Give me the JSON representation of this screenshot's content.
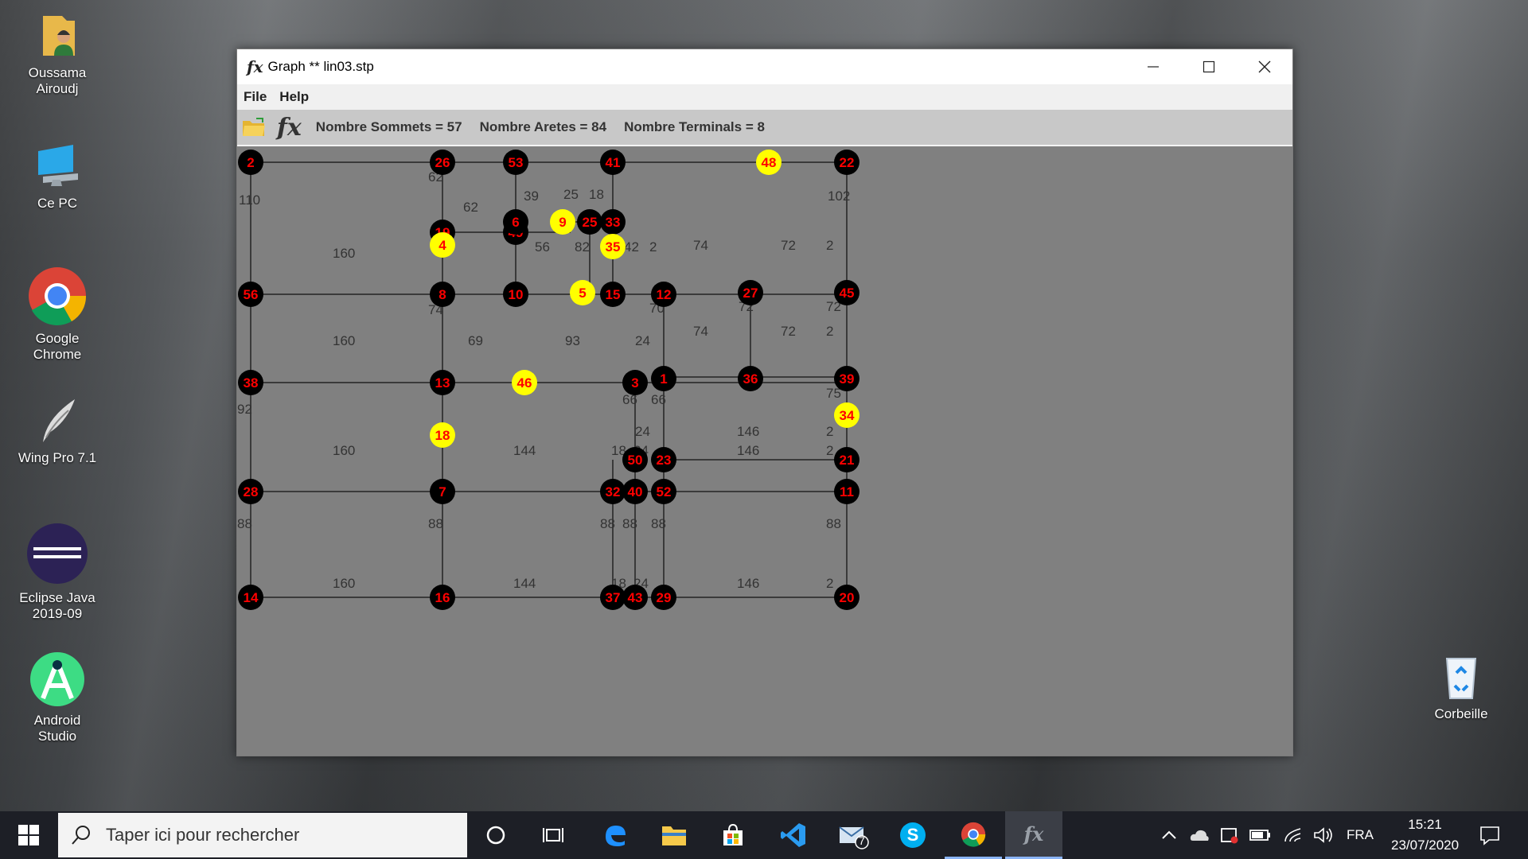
{
  "desktop": {
    "icons": [
      {
        "label": "Oussama Airoudj",
        "icon": "user-folder-icon"
      },
      {
        "label": "Ce PC",
        "icon": "computer-icon"
      },
      {
        "label": "Google Chrome",
        "icon": "chrome-icon"
      },
      {
        "label": "Wing Pro 7.1",
        "icon": "wing-icon"
      },
      {
        "label": "Eclipse Java 2019-09",
        "icon": "eclipse-icon"
      },
      {
        "label": "Android Studio",
        "icon": "android-studio-icon"
      },
      {
        "label": "Corbeille",
        "icon": "recycle-bin-icon"
      }
    ]
  },
  "window": {
    "fx_glyph": "fx",
    "title": "Graph ** lin03.stp",
    "menu": [
      "File",
      "Help"
    ],
    "toolbar_fx": "fx",
    "stats": [
      "Nombre Sommets = 57",
      "Nombre Aretes = 84",
      "Nombre Terminals = 8"
    ],
    "colors": {
      "background": "#808080",
      "edge": "#3a3a3a",
      "node": "#000000",
      "terminal": "#ffff00",
      "label": "#ff0000",
      "weight": "#333333"
    }
  },
  "graph": {
    "nodes": [
      {
        "id": "2",
        "terminal": false
      },
      {
        "id": "26",
        "terminal": false
      },
      {
        "id": "53",
        "terminal": false
      },
      {
        "id": "41",
        "terminal": false
      },
      {
        "id": "48",
        "terminal": true
      },
      {
        "id": "22",
        "terminal": false
      },
      {
        "id": "6",
        "terminal": false
      },
      {
        "id": "9",
        "terminal": true
      },
      {
        "id": "25",
        "terminal": false
      },
      {
        "id": "33",
        "terminal": false
      },
      {
        "id": "4",
        "terminal": true
      },
      {
        "id": "35",
        "terminal": true
      },
      {
        "id": "49",
        "terminal": false
      },
      {
        "id": "19",
        "terminal": false
      },
      {
        "id": "56",
        "terminal": false
      },
      {
        "id": "8",
        "terminal": false
      },
      {
        "id": "10",
        "terminal": false
      },
      {
        "id": "5",
        "terminal": true
      },
      {
        "id": "15",
        "terminal": false
      },
      {
        "id": "12",
        "terminal": false
      },
      {
        "id": "27",
        "terminal": false
      },
      {
        "id": "45",
        "terminal": false
      },
      {
        "id": "38",
        "terminal": false
      },
      {
        "id": "13",
        "terminal": false
      },
      {
        "id": "46",
        "terminal": true
      },
      {
        "id": "3",
        "terminal": false
      },
      {
        "id": "1",
        "terminal": false
      },
      {
        "id": "36",
        "terminal": false
      },
      {
        "id": "39",
        "terminal": false
      },
      {
        "id": "18",
        "terminal": true
      },
      {
        "id": "34",
        "terminal": true
      },
      {
        "id": "50",
        "terminal": false
      },
      {
        "id": "23",
        "terminal": false
      },
      {
        "id": "21",
        "terminal": false
      },
      {
        "id": "28",
        "terminal": false
      },
      {
        "id": "7",
        "terminal": false
      },
      {
        "id": "32",
        "terminal": false
      },
      {
        "id": "40",
        "terminal": false
      },
      {
        "id": "52",
        "terminal": false
      },
      {
        "id": "11",
        "terminal": false
      },
      {
        "id": "14",
        "terminal": false
      },
      {
        "id": "16",
        "terminal": false
      },
      {
        "id": "37",
        "terminal": false
      },
      {
        "id": "43",
        "terminal": false
      },
      {
        "id": "29",
        "terminal": false
      },
      {
        "id": "20",
        "terminal": false
      }
    ],
    "weights": [
      "110",
      "62",
      "39",
      "25",
      "18",
      "102",
      "62",
      "56",
      "82",
      "42",
      "2",
      "74",
      "72",
      "2",
      "160",
      "74",
      "70",
      "72",
      "72",
      "160",
      "69",
      "93",
      "24",
      "74",
      "72",
      "2",
      "92",
      "75",
      "66",
      "66",
      "24",
      "146",
      "2",
      "160",
      "144",
      "18",
      "24",
      "146",
      "2",
      "88",
      "88",
      "88",
      "88",
      "88",
      "88",
      "160",
      "144",
      "18",
      "24",
      "146",
      "2"
    ]
  },
  "taskbar": {
    "search_placeholder": "Taper ici pour rechercher",
    "mail_badge": "7",
    "skype_letter": "S",
    "fx_glyph": "fx",
    "language": "FRA",
    "time": "15:21",
    "date": "23/07/2020"
  }
}
